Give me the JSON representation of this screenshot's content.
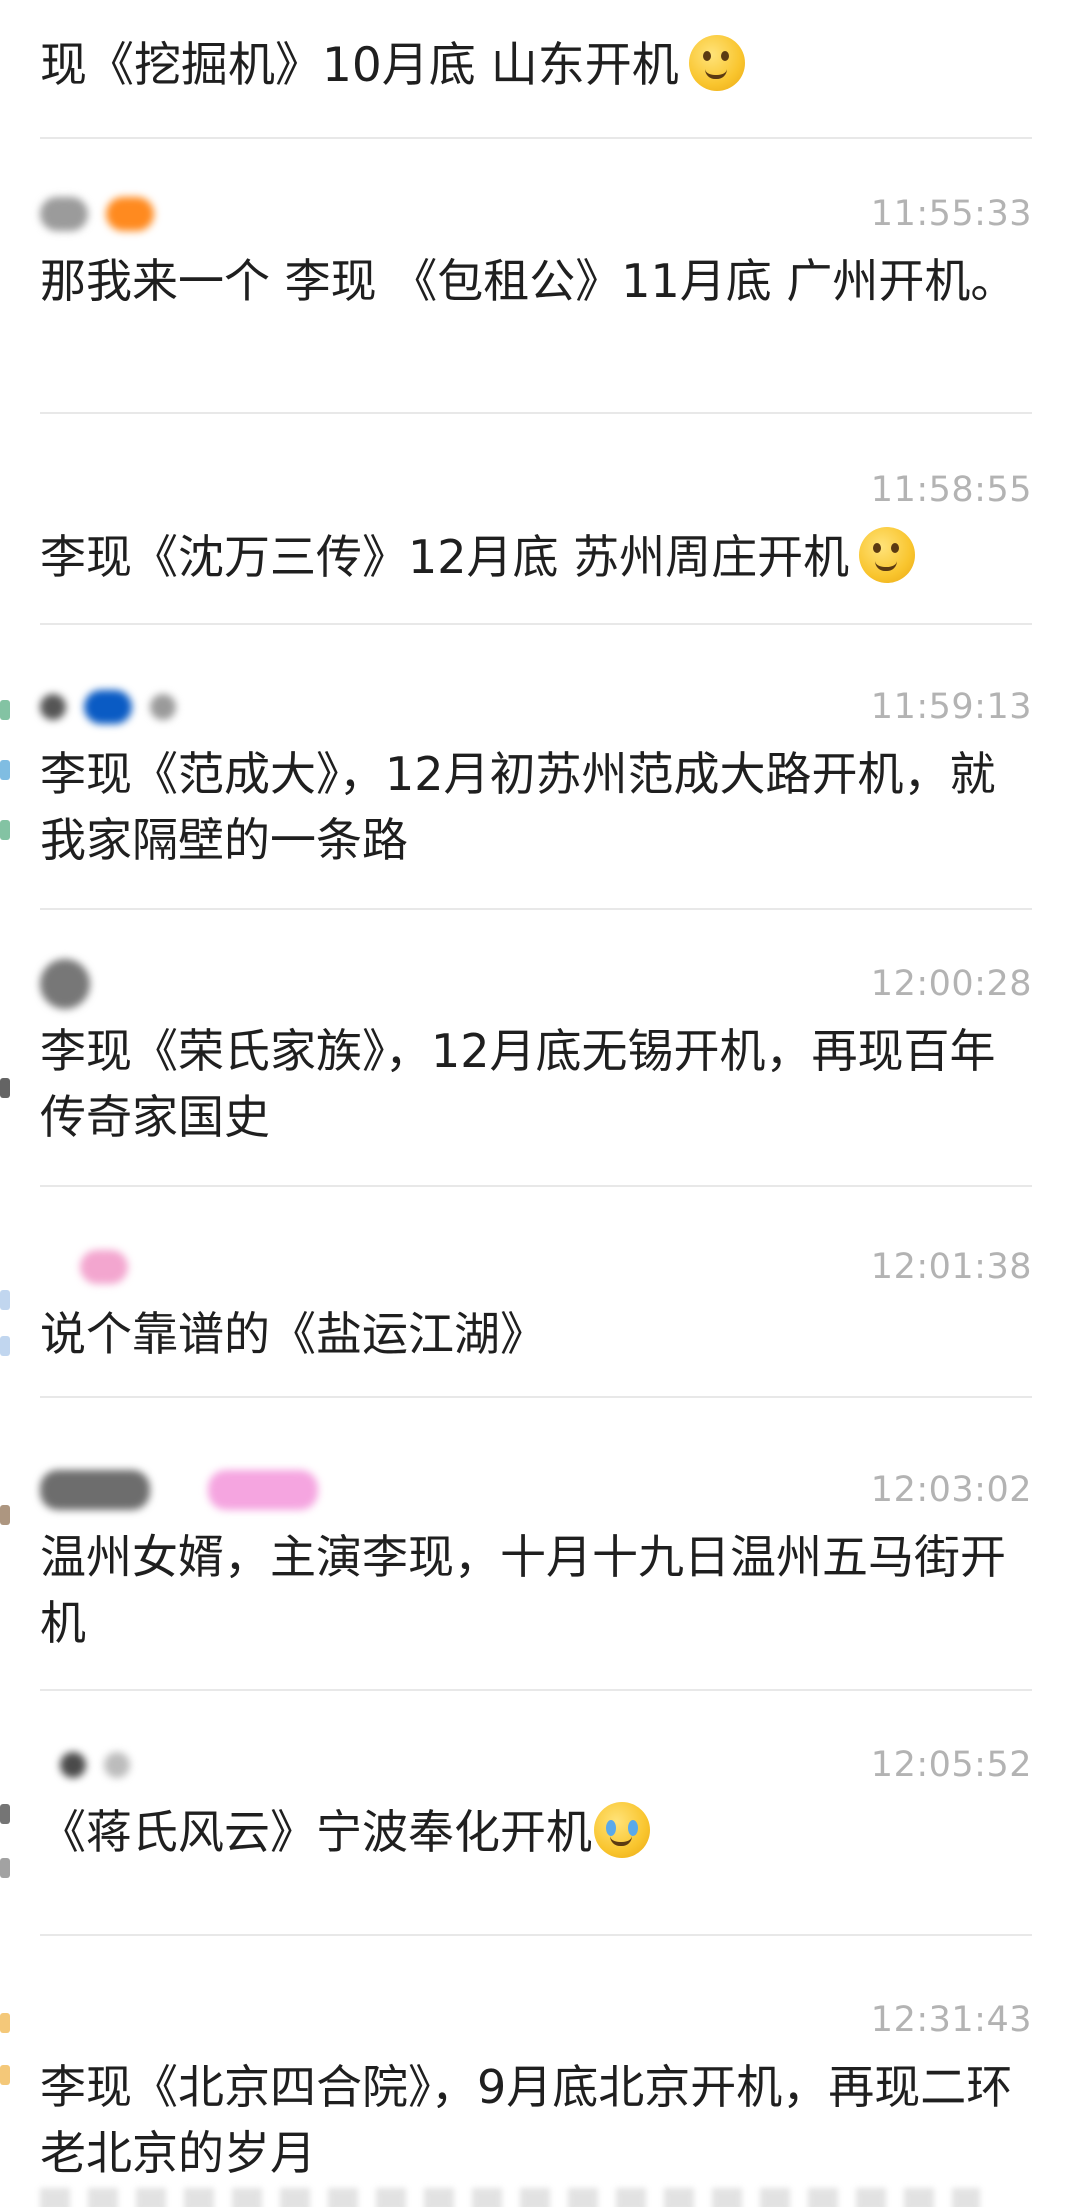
{
  "top_partial": {
    "text": "现《挖掘机》10月底 山东开机",
    "emoji": "thinking-face"
  },
  "comments": [
    {
      "timestamp": "11:55:33",
      "text": "那我来一个 李现 《包租公》11月底 广州开机。",
      "emoji": "",
      "avatar_colors": [
        "#9b9b9b",
        "#ff8a1f"
      ]
    },
    {
      "timestamp": "11:58:55",
      "text": "李现《沈万三传》12月底 苏州周庄开机",
      "emoji": "thinking-face",
      "avatar_colors": []
    },
    {
      "timestamp": "11:59:13",
      "text": "李现《范成大》，12月初苏州范成大路开机，就我家隔壁的一条路",
      "emoji": "",
      "avatar_colors": [
        "#555555",
        "#0a5bc4",
        "#9a9a9a"
      ]
    },
    {
      "timestamp": "12:00:28",
      "text": "李现《荣氏家族》，12月底无锡开机，再现百年传奇家国史",
      "emoji": "",
      "avatar_colors": [
        "#777777"
      ]
    },
    {
      "timestamp": "12:01:38",
      "text": "说个靠谱的《盐运江湖》",
      "emoji": "",
      "avatar_colors": [
        "#f3a6cf"
      ]
    },
    {
      "timestamp": "12:03:02",
      "text": "温州女婿，主演李现，十月十九日温州五马街开机",
      "emoji": "",
      "avatar_colors": [
        "#6d6d6d",
        "#f5a5e0"
      ]
    },
    {
      "timestamp": "12:05:52",
      "text": "《蒋氏风云》宁波奉化开机",
      "emoji": "face-crying",
      "avatar_colors": [
        "#4a4a4a",
        "#bcbcbc"
      ]
    },
    {
      "timestamp": "12:31:43",
      "text": "李现《北京四合院》，9月底北京开机，再现二环老北京的岁月",
      "emoji": "",
      "avatar_colors": []
    }
  ],
  "colors": {
    "text": "#1f1f1f",
    "timestamp": "#b3b3b3",
    "divider": "#e8e8e8",
    "background": "#ffffff"
  }
}
